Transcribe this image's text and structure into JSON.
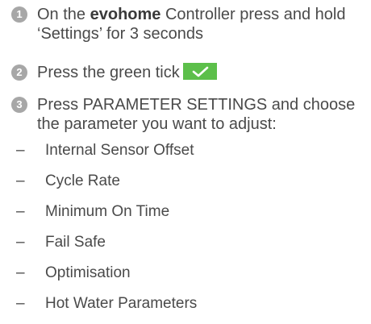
{
  "steps": [
    {
      "number": "1",
      "text_before": "On the ",
      "brand": "evohome",
      "text_after": " Controller press and hold ‘Settings’ for 3 seconds"
    },
    {
      "number": "2",
      "text": "Press the green tick",
      "tick_icon": "checkmark-icon",
      "tick_color": "#5cbf4a"
    },
    {
      "number": "3",
      "text": "Press PARAMETER SETTINGS and choose the parameter you want to adjust:"
    }
  ],
  "parameters": [
    "Internal Sensor Offset",
    "Cycle Rate",
    "Minimum On Time",
    "Fail Safe",
    "Optimisation",
    "Hot Water Parameters"
  ],
  "bullet": "–"
}
